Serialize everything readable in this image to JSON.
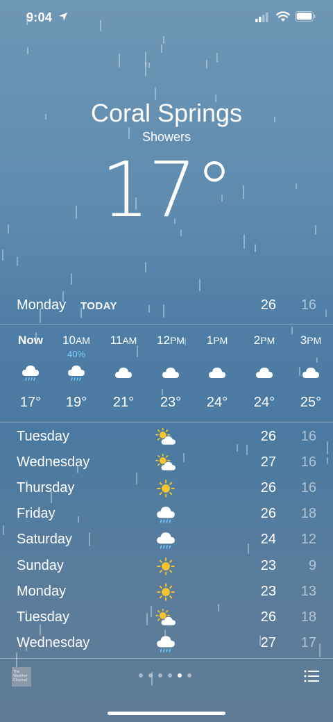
{
  "status": {
    "time": "9:04"
  },
  "location": {
    "city": "Coral Springs",
    "condition": "Showers",
    "temperature": "17°"
  },
  "today": {
    "day": "Monday",
    "tag": "TODAY",
    "high": "26",
    "low": "16"
  },
  "hourly": [
    {
      "label": "Now",
      "suffix": "",
      "precip": "",
      "icon": "cloud-rain-icon",
      "temp": "17°"
    },
    {
      "label": "10",
      "suffix": "AM",
      "precip": "40%",
      "icon": "cloud-rain-icon",
      "temp": "19°"
    },
    {
      "label": "11",
      "suffix": "AM",
      "precip": "",
      "icon": "cloud-icon",
      "temp": "21°"
    },
    {
      "label": "12",
      "suffix": "PM",
      "precip": "",
      "icon": "cloud-icon",
      "temp": "23°"
    },
    {
      "label": "1",
      "suffix": "PM",
      "precip": "",
      "icon": "cloud-icon",
      "temp": "24°"
    },
    {
      "label": "2",
      "suffix": "PM",
      "precip": "",
      "icon": "cloud-icon",
      "temp": "24°"
    },
    {
      "label": "3",
      "suffix": "PM",
      "precip": "",
      "icon": "cloud-icon",
      "temp": "25°"
    }
  ],
  "daily": [
    {
      "day": "Tuesday",
      "icon": "partly-sunny-icon",
      "high": "26",
      "low": "16"
    },
    {
      "day": "Wednesday",
      "icon": "partly-sunny-icon",
      "high": "27",
      "low": "16"
    },
    {
      "day": "Thursday",
      "icon": "sun-icon",
      "high": "26",
      "low": "16"
    },
    {
      "day": "Friday",
      "icon": "cloud-rain-icon",
      "high": "26",
      "low": "18"
    },
    {
      "day": "Saturday",
      "icon": "cloud-rain-icon",
      "high": "24",
      "low": "12"
    },
    {
      "day": "Sunday",
      "icon": "sun-icon",
      "high": "23",
      "low": "9"
    },
    {
      "day": "Monday",
      "icon": "sun-icon",
      "high": "23",
      "low": "13"
    },
    {
      "day": "Tuesday",
      "icon": "partly-sunny-icon",
      "high": "26",
      "low": "18"
    },
    {
      "day": "Wednesday",
      "icon": "cloud-rain-icon",
      "high": "27",
      "low": "17"
    }
  ],
  "footer": {
    "logo_text": [
      "The",
      "Weather",
      "Channel"
    ],
    "page_count": 6,
    "active_page": 4
  },
  "colors": {
    "sun": "#f7c52b",
    "rain": "#6ec6ff",
    "precip_text": "#7fd0ff"
  }
}
